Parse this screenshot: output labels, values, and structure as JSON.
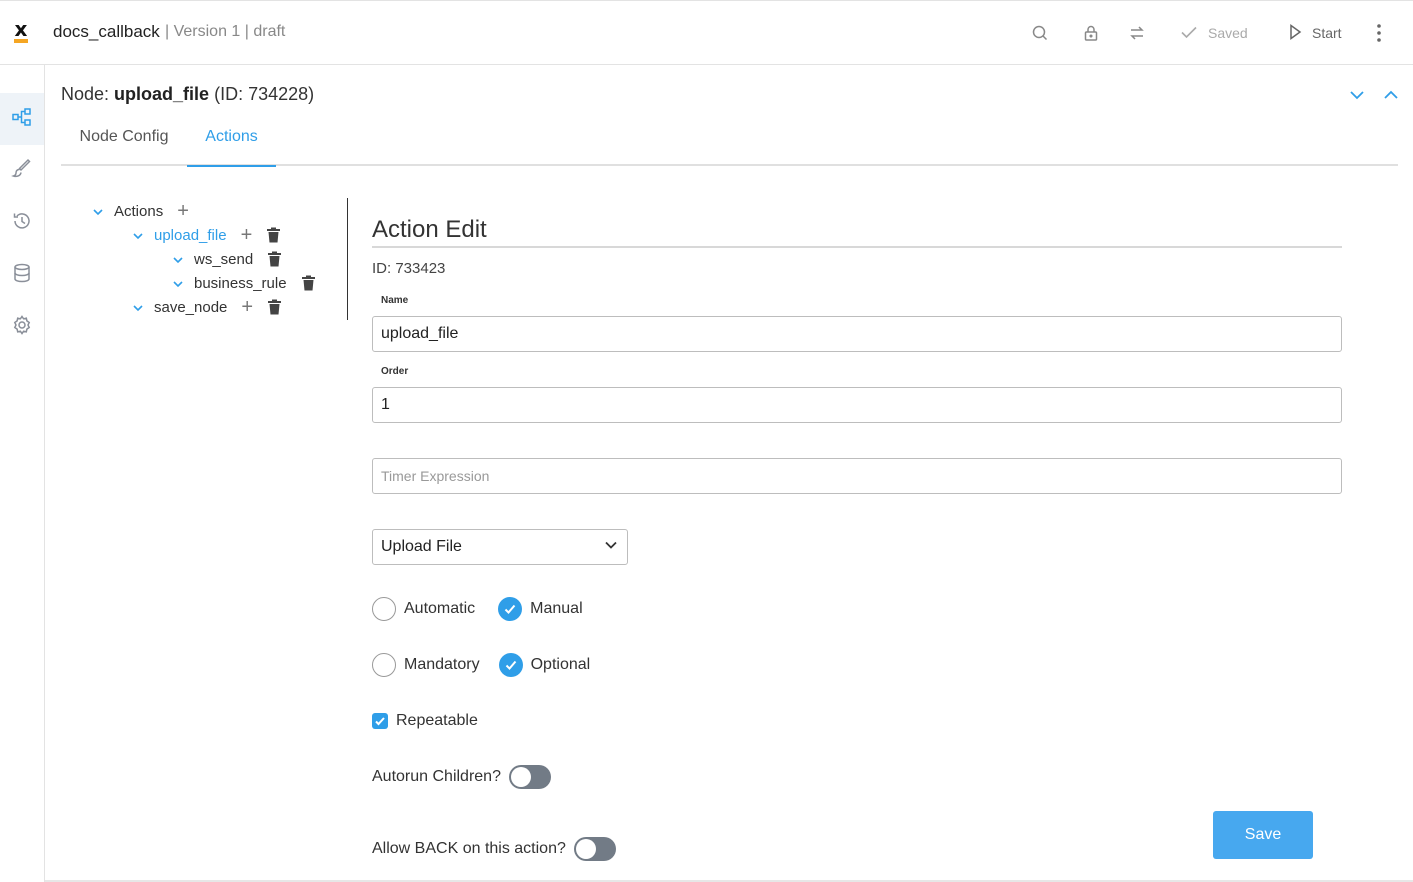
{
  "header": {
    "app_title": "docs_callback",
    "subtitle": "| Version 1 | draft",
    "saved_label": "Saved",
    "start_label": "Start",
    "icons": [
      "search-icon",
      "lock-icon",
      "swap-icon",
      "check-icon",
      "play-icon",
      "kebab-icon"
    ]
  },
  "sidebar": {
    "items": [
      {
        "icon": "flow-diagram-icon",
        "active": true
      },
      {
        "icon": "brush-icon",
        "active": false
      },
      {
        "icon": "history-icon",
        "active": false
      },
      {
        "icon": "database-icon",
        "active": false
      },
      {
        "icon": "gear-icon",
        "active": false
      }
    ]
  },
  "node": {
    "prefix": "Node: ",
    "name": "upload_file",
    "id_text": "(ID: 734228)"
  },
  "tabs": [
    {
      "label": "Node Config",
      "active": false
    },
    {
      "label": "Actions",
      "active": true
    }
  ],
  "tree": {
    "root": "Actions",
    "upload_file": "upload_file",
    "ws_send": "ws_send",
    "business_rule": "business_rule",
    "save_node": "save_node"
  },
  "edit": {
    "heading": "Action Edit",
    "id_text": "ID: 733423",
    "name_label": "Name",
    "name_value": "upload_file",
    "order_label": "Order",
    "order_value": "1",
    "timer_placeholder": "Timer Expression",
    "action_type": "Upload File",
    "trigger": {
      "automatic": "Automatic",
      "manual": "Manual",
      "selected": "Manual"
    },
    "requirement": {
      "mandatory": "Mandatory",
      "optional": "Optional",
      "selected": "Optional"
    },
    "repeatable_label": "Repeatable",
    "repeatable_checked": true,
    "autorun_label": "Autorun Children?",
    "autorun_on": false,
    "allow_back_label": "Allow BACK on this action?",
    "allow_back_on": false,
    "save_label": "Save"
  },
  "colors": {
    "accent": "#2f9ee8",
    "save_button": "#47a8ef",
    "logo_bar": "#f5a623",
    "toggle_off": "#727b86"
  }
}
